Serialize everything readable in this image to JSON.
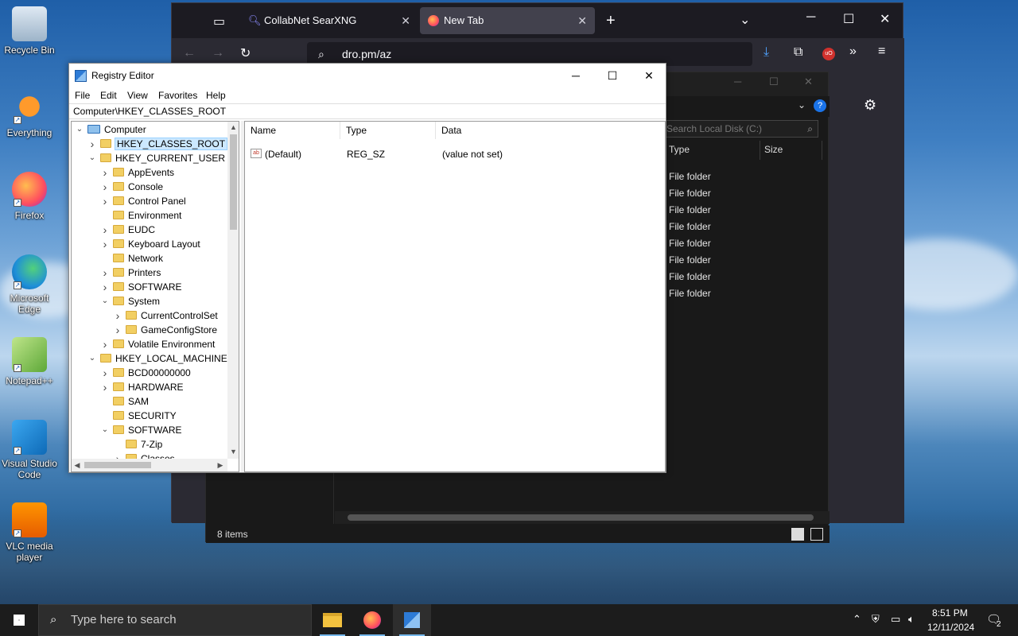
{
  "desktop": {
    "icons": [
      {
        "label": "Recycle Bin",
        "icon": "recycle-bin-icon"
      },
      {
        "label": "Everything",
        "icon": "everything-search-icon"
      },
      {
        "label": "Firefox",
        "icon": "firefox-icon"
      },
      {
        "label": "Microsoft Edge",
        "icon": "edge-icon"
      },
      {
        "label": "Notepad++",
        "icon": "notepad-plus-plus-icon"
      },
      {
        "label": "Visual Studio Code",
        "icon": "vscode-icon"
      },
      {
        "label": "VLC media player",
        "icon": "vlc-icon"
      }
    ]
  },
  "firefox": {
    "tabs": [
      {
        "label": "CollabNet SearXNG"
      },
      {
        "label": "New Tab"
      }
    ],
    "url": "dro.pm/az"
  },
  "explorer": {
    "search_placeholder": "Search Local Disk (C:)",
    "columns": [
      "Type",
      "Size"
    ],
    "rows": [
      "File folder",
      "File folder",
      "File folder",
      "File folder",
      "File folder",
      "File folder",
      "File folder",
      "File folder"
    ],
    "status": "8 items"
  },
  "regedit": {
    "title": "Registry Editor",
    "menu": [
      "File",
      "Edit",
      "View",
      "Favorites",
      "Help"
    ],
    "address": "Computer\\HKEY_CLASSES_ROOT",
    "tree": [
      {
        "label": "Computer",
        "level": 0,
        "arrow": "expanded",
        "computer": true
      },
      {
        "label": "HKEY_CLASSES_ROOT",
        "level": 1,
        "arrow": "collapsed",
        "selected": true
      },
      {
        "label": "HKEY_CURRENT_USER",
        "level": 1,
        "arrow": "expanded"
      },
      {
        "label": "AppEvents",
        "level": 2,
        "arrow": "collapsed"
      },
      {
        "label": "Console",
        "level": 2,
        "arrow": "collapsed"
      },
      {
        "label": "Control Panel",
        "level": 2,
        "arrow": "collapsed"
      },
      {
        "label": "Environment",
        "level": 2,
        "arrow": "none"
      },
      {
        "label": "EUDC",
        "level": 2,
        "arrow": "collapsed"
      },
      {
        "label": "Keyboard Layout",
        "level": 2,
        "arrow": "collapsed"
      },
      {
        "label": "Network",
        "level": 2,
        "arrow": "none"
      },
      {
        "label": "Printers",
        "level": 2,
        "arrow": "collapsed"
      },
      {
        "label": "SOFTWARE",
        "level": 2,
        "arrow": "collapsed"
      },
      {
        "label": "System",
        "level": 2,
        "arrow": "expanded"
      },
      {
        "label": "CurrentControlSet",
        "level": 3,
        "arrow": "collapsed"
      },
      {
        "label": "GameConfigStore",
        "level": 3,
        "arrow": "collapsed"
      },
      {
        "label": "Volatile Environment",
        "level": 2,
        "arrow": "collapsed"
      },
      {
        "label": "HKEY_LOCAL_MACHINE",
        "level": 1,
        "arrow": "expanded"
      },
      {
        "label": "BCD00000000",
        "level": 2,
        "arrow": "collapsed"
      },
      {
        "label": "HARDWARE",
        "level": 2,
        "arrow": "collapsed"
      },
      {
        "label": "SAM",
        "level": 2,
        "arrow": "none"
      },
      {
        "label": "SECURITY",
        "level": 2,
        "arrow": "none"
      },
      {
        "label": "SOFTWARE",
        "level": 2,
        "arrow": "expanded"
      },
      {
        "label": "7-Zip",
        "level": 3,
        "arrow": "none"
      },
      {
        "label": "Classes",
        "level": 3,
        "arrow": "collapsed"
      }
    ],
    "value_columns": [
      "Name",
      "Type",
      "Data"
    ],
    "values": [
      {
        "name": "(Default)",
        "type": "REG_SZ",
        "data": "(value not set)"
      }
    ]
  },
  "taskbar": {
    "search_placeholder": "Type here to search",
    "time": "8:51 PM",
    "date": "12/11/2024",
    "notifications": "2"
  }
}
